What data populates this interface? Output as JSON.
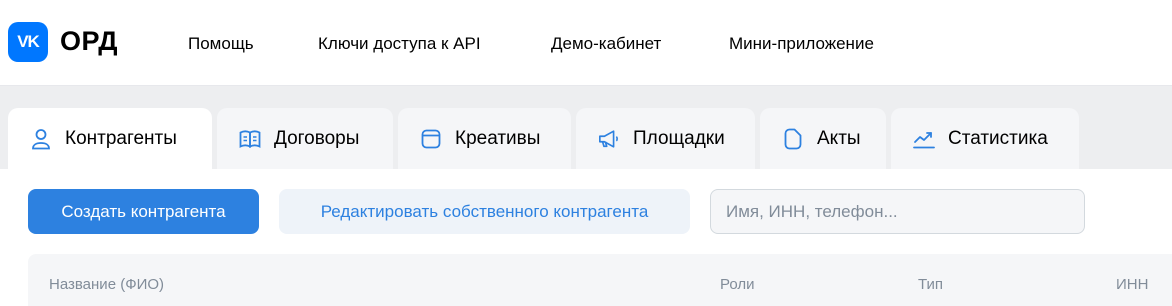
{
  "header": {
    "logo_text": "VK",
    "brand": "ОРД",
    "nav": [
      {
        "label": "Помощь"
      },
      {
        "label": "Ключи доступа к API"
      },
      {
        "label": "Демо-кабинет"
      },
      {
        "label": "Мини-приложение"
      }
    ]
  },
  "tabs": [
    {
      "label": "Контрагенты",
      "icon": "user-icon",
      "active": true
    },
    {
      "label": "Договоры",
      "icon": "book-icon"
    },
    {
      "label": "Креативы",
      "icon": "window-icon"
    },
    {
      "label": "Площадки",
      "icon": "megaphone-icon"
    },
    {
      "label": "Акты",
      "icon": "document-icon"
    },
    {
      "label": "Статистика",
      "icon": "chart-icon"
    }
  ],
  "toolbar": {
    "create_label": "Создать контрагента",
    "edit_own_label": "Редактировать собственного контрагента",
    "search_placeholder": "Имя, ИНН, телефон..."
  },
  "table": {
    "columns": [
      "Название (ФИО)",
      "Роли",
      "Тип",
      "ИНН"
    ]
  },
  "colors": {
    "accent": "#2d81e0",
    "brand": "#0077ff",
    "muted_text": "#818c99"
  }
}
